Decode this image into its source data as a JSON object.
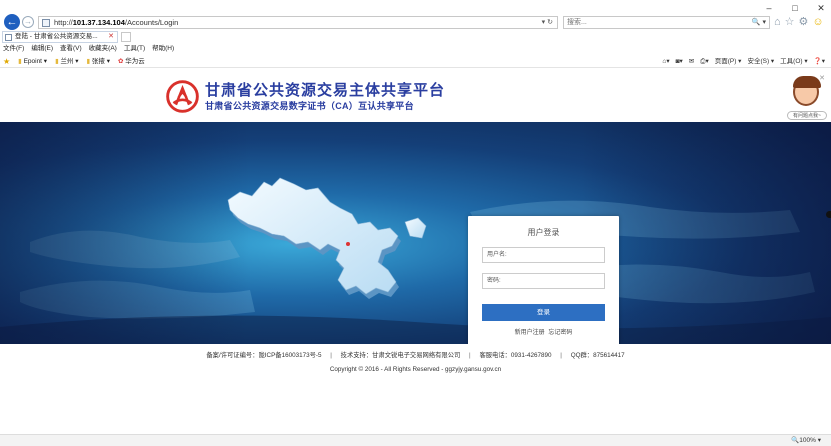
{
  "browser": {
    "address": "http://101.37.134.104/Accounts/Login",
    "address_host": "101.37.134.104",
    "address_prefix": "http://",
    "address_path": "/Accounts/Login",
    "address_tools": "▾ ↻",
    "search_placeholder": "搜索...",
    "search_tools": "🔍 ▾",
    "tab_title": "登陆 - 甘肃省公共资源交易...",
    "menu": [
      "文件(F)",
      "编辑(E)",
      "查看(V)",
      "收藏夹(A)",
      "工具(T)",
      "帮助(H)"
    ],
    "favorites": [
      "Epoint ▾",
      "兰州 ▾",
      "张掖 ▾",
      "华为云"
    ],
    "command_bar": [
      "▾",
      "▾",
      "▾",
      "页面(P) ▾",
      "安全(S) ▾",
      "工具(O) ▾",
      "▾"
    ],
    "window_controls": [
      "–",
      "□",
      "✕"
    ],
    "zoom": "🔍100%",
    "zoom_menu": "▾"
  },
  "site": {
    "title": "甘肃省公共资源交易主体共享平台",
    "subtitle": "甘肃省公共资源交易数字证书（CA）互认共享平台",
    "helper_label": "有问题点我~",
    "helper_close": "✕"
  },
  "login": {
    "title": "用户登录",
    "username_label": "用户名:",
    "password_label": "密码:",
    "submit": "登录",
    "register_link": "新用户注册",
    "forgot_link": "忘记密码"
  },
  "footer": {
    "license": "备案/许可证编号：陇ICP备16003173号-5",
    "tech_support": "技术支持：甘肃文锐电子交易网络有限公司",
    "hotline": "客服电话：0931-4267890",
    "qq": "QQ群：875614417",
    "separator": "|",
    "copyright": "Copyright © 2016 - All Rights Reserved - ggzyjy.gansu.gov.cn"
  },
  "colors": {
    "brand_title": "#2a3ea0",
    "login_button": "#2d6fc2",
    "logo_red": "#d9312b"
  }
}
